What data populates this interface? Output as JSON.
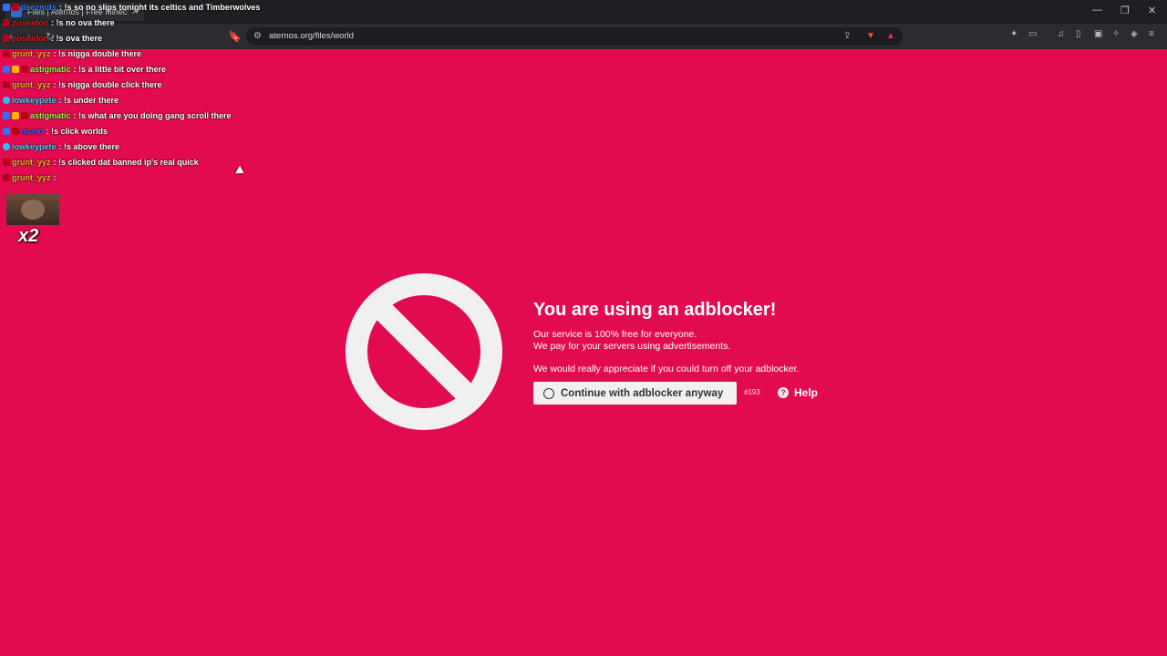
{
  "browser": {
    "tab_title": "Files | Aternos | Free Minecraft",
    "url": "aternos.org/files/world"
  },
  "chat": [
    {
      "user": "deeznuts",
      "msg": ": !s so no slips tonight its celtics and Timberwolves",
      "badges": [
        "blue",
        "red"
      ],
      "color": "#3b7bff"
    },
    {
      "user": "poseidon",
      "msg": ": !s no ova there",
      "badges": [
        "red"
      ],
      "color": "#d42222"
    },
    {
      "user": "poseidon",
      "msg": ": !s ova there",
      "badges": [
        "red"
      ],
      "color": "#d42222"
    },
    {
      "user": "grunt_yyz",
      "msg": " : !s nigga double there",
      "badges": [
        "red"
      ],
      "color": "#ffb22e"
    },
    {
      "user": "astigmatic",
      "msg": " : !s a little bit over there",
      "badges": [
        "blue",
        "gold",
        "red"
      ],
      "color": "#9bff4a"
    },
    {
      "user": "grunt_yyz",
      "msg": " : !s nigga double click there",
      "badges": [
        "red"
      ],
      "color": "#ffb22e"
    },
    {
      "user": "lowkeypete",
      "msg": " : !s under there",
      "badges": [
        "cyan"
      ],
      "color": "#4fd0ff"
    },
    {
      "user": "astigmatic",
      "msg": " : !s what are you doing gang scroll there",
      "badges": [
        "blue",
        "gold",
        "red"
      ],
      "color": "#9bff4a"
    },
    {
      "user": "mood",
      "msg": " : !s click worlds",
      "badges": [
        "blue",
        "red"
      ],
      "color": "#5a5aff"
    },
    {
      "user": "lowkeypete",
      "msg": " : !s above there",
      "badges": [
        "cyan"
      ],
      "color": "#4fd0ff"
    },
    {
      "user": "grunt_yyz",
      "msg": " : !s clicked dat banned ip's real quick",
      "badges": [
        "red"
      ],
      "color": "#ffb22e"
    },
    {
      "user": "grunt_yyz",
      "msg": " : ",
      "badges": [
        "red"
      ],
      "color": "#ffb22e"
    }
  ],
  "emote_count": "x2",
  "adblock": {
    "title": "You are using an adblocker!",
    "line1": "Our service is 100% free for everyone.",
    "line2": "We pay for your servers using advertisements.",
    "line3": "We would really appreciate if you could turn off your adblocker.",
    "continue_label": "Continue with adblocker anyway",
    "code": "#193",
    "help_label": "Help"
  },
  "colors": {
    "background": "#e30b4f",
    "button": "#f0f0f0"
  }
}
